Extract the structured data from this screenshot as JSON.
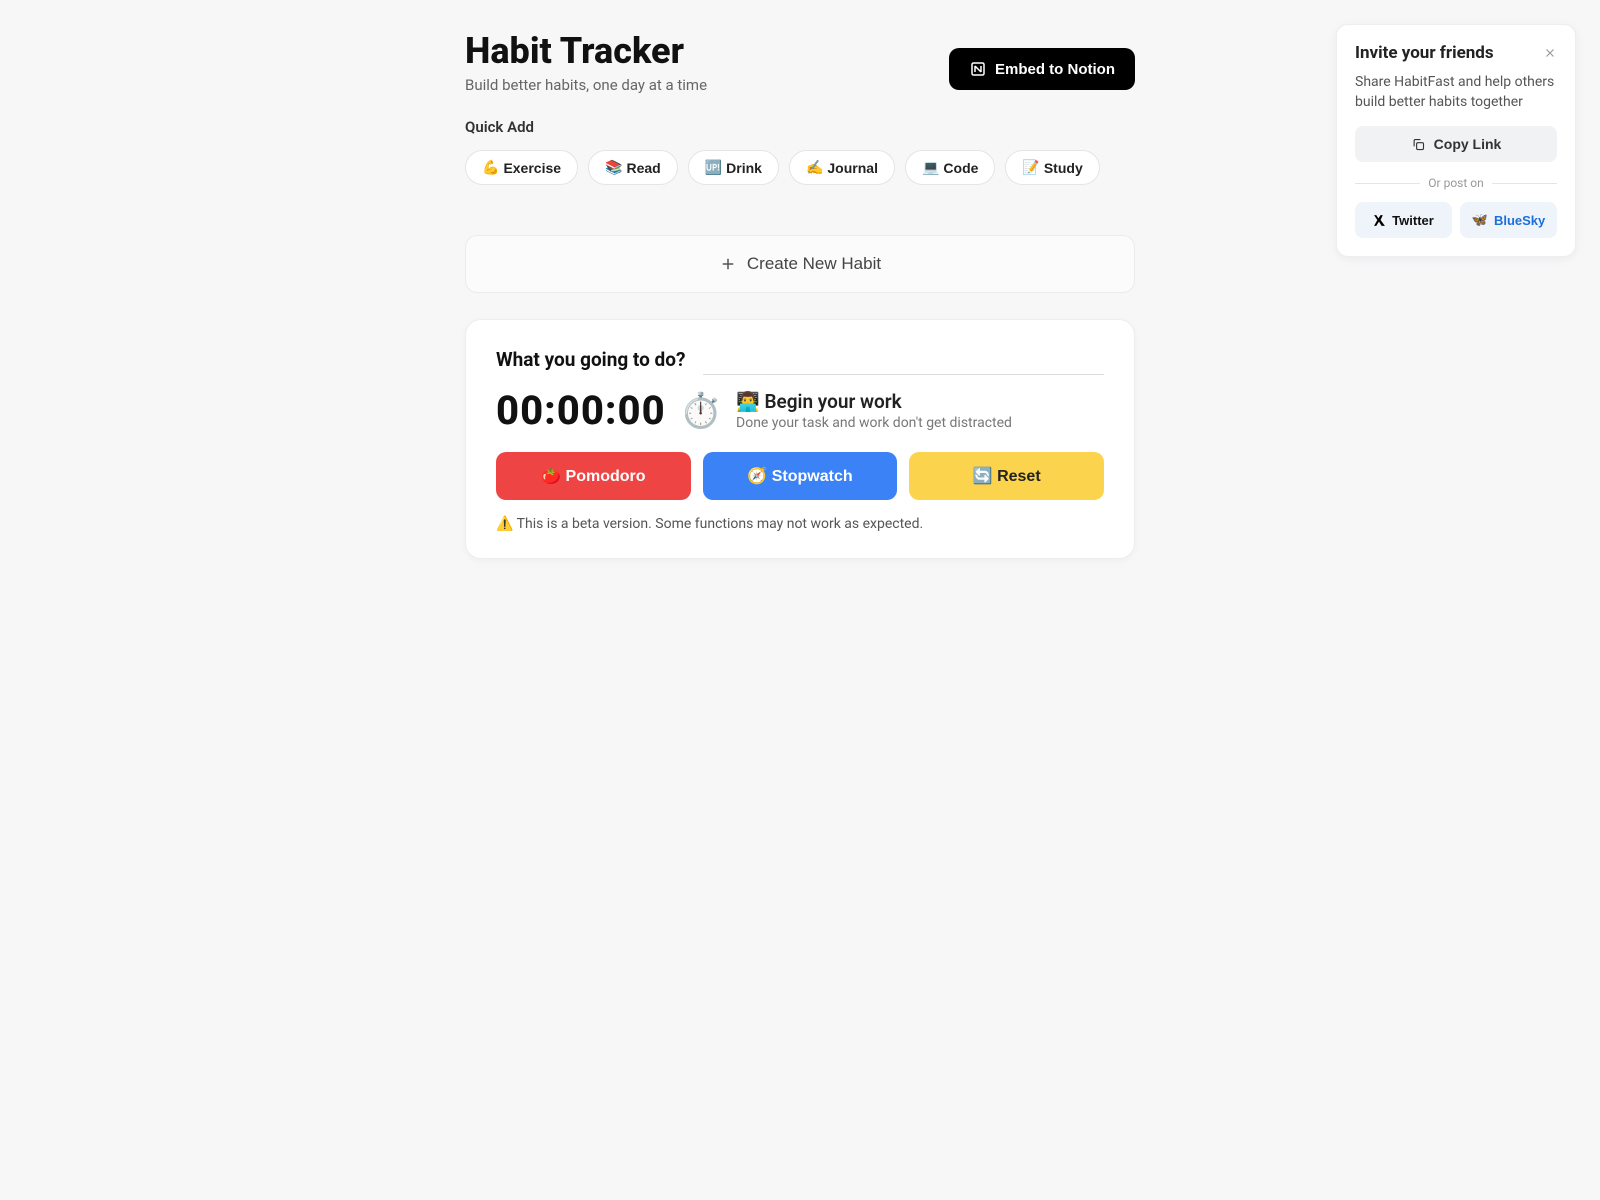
{
  "header": {
    "title": "Habit Tracker",
    "subtitle": "Build better habits, one day at a time",
    "embed_label": "Embed to Notion"
  },
  "quick_add": {
    "label": "Quick Add",
    "items": [
      {
        "emoji": "💪",
        "label": "Exercise"
      },
      {
        "emoji": "📚",
        "label": "Read"
      },
      {
        "emoji": "🆙",
        "label": "Drink"
      },
      {
        "emoji": "✍️",
        "label": "Journal"
      },
      {
        "emoji": "💻",
        "label": "Code"
      },
      {
        "emoji": "📝",
        "label": "Study"
      }
    ]
  },
  "create_habit_label": "Create New Habit",
  "timer": {
    "what_label": "What you going to do?",
    "value": "00:00:00",
    "stopwatch_emoji": "⏱️",
    "begin_emoji": "👨‍💻",
    "begin_label": "Begin your work",
    "begin_subtext": "Done your task and work don't get distracted",
    "buttons": {
      "pomodoro": "🍅 Pomodoro",
      "stopwatch": "🧭 Stopwatch",
      "reset": "🔄 Reset"
    },
    "beta_warning": "⚠️ This is a beta version. Some functions may not work as expected."
  },
  "invite": {
    "title": "Invite your friends",
    "desc": "Share HabitFast and help others build better habits together",
    "copy_link": "Copy Link",
    "or_post": "Or post on",
    "twitter": "Twitter",
    "bluesky_emoji": "🦋",
    "bluesky": "BlueSky"
  }
}
